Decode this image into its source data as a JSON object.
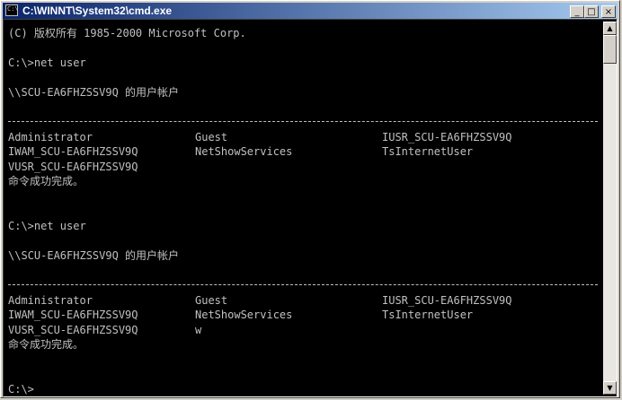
{
  "window": {
    "title": "C:\\WINNT\\System32\\cmd.exe",
    "app_icon": "C:\\"
  },
  "title_buttons": {
    "minimize": "_",
    "maximize": "□",
    "close": "×"
  },
  "console": {
    "copyright": "(C) 版权所有 1985-2000 Microsoft Corp.",
    "blocks": [
      {
        "command": "C:\\>net user",
        "header": "\\\\SCU-EA6FHZSSV9Q 的用户帐户",
        "rows": [
          [
            "Administrator",
            "Guest",
            "IUSR_SCU-EA6FHZSSV9Q"
          ],
          [
            "IWAM_SCU-EA6FHZSSV9Q",
            "NetShowServices",
            "TsInternetUser"
          ],
          [
            "VUSR_SCU-EA6FHZSSV9Q",
            "",
            ""
          ]
        ],
        "result": "命令成功完成。"
      },
      {
        "command": "C:\\>net user",
        "header": "\\\\SCU-EA6FHZSSV9Q 的用户帐户",
        "rows": [
          [
            "Administrator",
            "Guest",
            "IUSR_SCU-EA6FHZSSV9Q"
          ],
          [
            "IWAM_SCU-EA6FHZSSV9Q",
            "NetShowServices",
            "TsInternetUser"
          ],
          [
            "VUSR_SCU-EA6FHZSSV9Q",
            "w",
            ""
          ]
        ],
        "result": "命令成功完成。"
      }
    ],
    "prompt": "C:\\>"
  },
  "scrollbar": {
    "up_arrow": "▲",
    "down_arrow": "▼"
  },
  "colors": {
    "console_bg": "#000000",
    "console_fg": "#c0c0c0",
    "titlebar_start": "#0a246a",
    "titlebar_end": "#a6caf0"
  },
  "icons": {
    "app": "cmd-icon",
    "minimize": "minimize-icon",
    "maximize": "maximize-icon",
    "close": "close-icon"
  }
}
